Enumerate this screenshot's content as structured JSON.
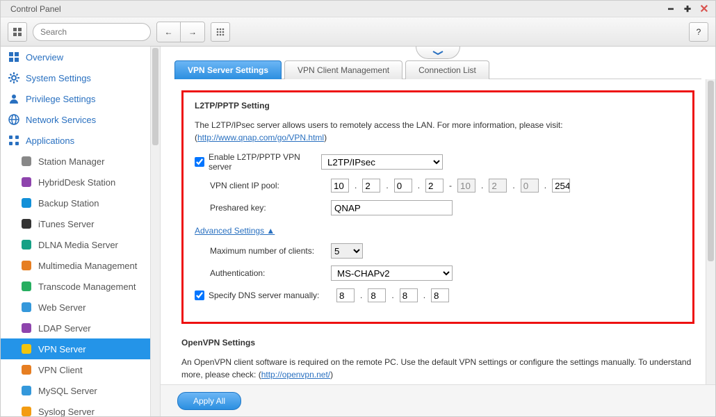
{
  "titlebar": {
    "title": "Control Panel"
  },
  "toolbar": {
    "search_placeholder": "Search"
  },
  "sidebar": {
    "top": [
      {
        "label": "Overview",
        "name": "sidebar-item-overview",
        "icon": "overview"
      },
      {
        "label": "System Settings",
        "name": "sidebar-item-system-settings",
        "icon": "settings"
      },
      {
        "label": "Privilege Settings",
        "name": "sidebar-item-privilege-settings",
        "icon": "privilege"
      },
      {
        "label": "Network Services",
        "name": "sidebar-item-network-services",
        "icon": "network"
      },
      {
        "label": "Applications",
        "name": "sidebar-item-applications",
        "icon": "apps"
      }
    ],
    "apps": [
      {
        "label": "Station Manager",
        "name": "sidebar-item-station-manager",
        "color": "#888"
      },
      {
        "label": "HybridDesk Station",
        "name": "sidebar-item-hybriddesk-station",
        "color": "#8e44ad"
      },
      {
        "label": "Backup Station",
        "name": "sidebar-item-backup-station",
        "color": "#1290d8"
      },
      {
        "label": "iTunes Server",
        "name": "sidebar-item-itunes-server",
        "color": "#333"
      },
      {
        "label": "DLNA Media Server",
        "name": "sidebar-item-dlna-media-server",
        "color": "#16a085"
      },
      {
        "label": "Multimedia Management",
        "name": "sidebar-item-multimedia-management",
        "color": "#e67e22"
      },
      {
        "label": "Transcode Management",
        "name": "sidebar-item-transcode-management",
        "color": "#27ae60"
      },
      {
        "label": "Web Server",
        "name": "sidebar-item-web-server",
        "color": "#3498db"
      },
      {
        "label": "LDAP Server",
        "name": "sidebar-item-ldap-server",
        "color": "#8e44ad"
      },
      {
        "label": "VPN Server",
        "name": "sidebar-item-vpn-server",
        "color": "#f1c40f",
        "active": true
      },
      {
        "label": "VPN Client",
        "name": "sidebar-item-vpn-client",
        "color": "#e67e22"
      },
      {
        "label": "MySQL Server",
        "name": "sidebar-item-mysql-server",
        "color": "#3498db"
      },
      {
        "label": "Syslog Server",
        "name": "sidebar-item-syslog-server",
        "color": "#f39c12"
      }
    ]
  },
  "tabs": [
    {
      "label": "VPN Server Settings",
      "active": true
    },
    {
      "label": "VPN Client Management",
      "active": false
    },
    {
      "label": "Connection List",
      "active": false
    }
  ],
  "l2tp": {
    "title": "L2TP/PPTP Setting",
    "desc_prefix": "The L2TP/IPsec server allows users to remotely access the LAN. For more information, please visit: (",
    "desc_link": "http://www.qnap.com/go/VPN.html",
    "desc_suffix": ")",
    "enable_label": "Enable L2TP/PPTP VPN server",
    "enable_checked": true,
    "protocol": "L2TP/IPsec",
    "ip_pool_label": "VPN client IP pool:",
    "ip_start": [
      "10",
      "2",
      "0",
      "2"
    ],
    "ip_end": [
      "10",
      "2",
      "0",
      "254"
    ],
    "psk_label": "Preshared key:",
    "psk_value": "QNAP",
    "advanced_label": "Advanced Settings ▲",
    "max_clients_label": "Maximum number of clients:",
    "max_clients": "5",
    "auth_label": "Authentication:",
    "auth_value": "MS-CHAPv2",
    "dns_label": "Specify DNS server manually:",
    "dns_checked": true,
    "dns": [
      "8",
      "8",
      "8",
      "8"
    ]
  },
  "openvpn": {
    "title": "OpenVPN Settings",
    "desc_prefix": "An OpenVPN client software is required on the remote PC. Use the default VPN settings or configure the settings manually. To understand more, please check: (",
    "desc_link": "http://openvpn.net/",
    "desc_suffix": ")"
  },
  "footer": {
    "apply_label": "Apply All"
  }
}
